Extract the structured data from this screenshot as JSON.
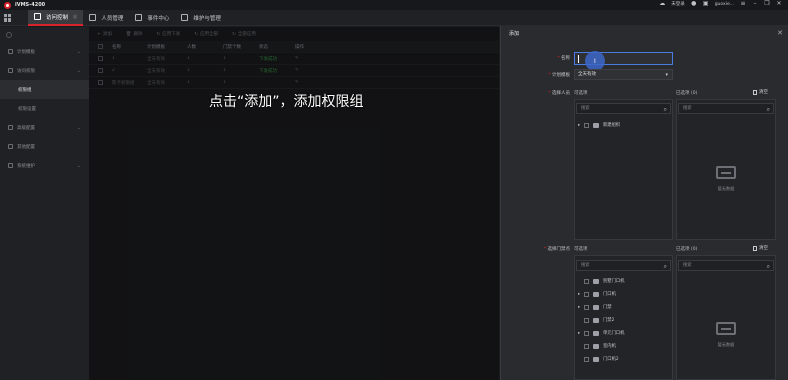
{
  "app": {
    "title": "iVMS-4200"
  },
  "titlebar": {
    "user": "guoxie...",
    "icons": [
      "cloud-icon",
      "user-icon",
      "image-icon",
      "menu-icon",
      "minimize-icon",
      "restore-icon",
      "close-icon"
    ],
    "login_label": "未登录"
  },
  "nav": {
    "tabs": [
      {
        "label": "访问控制",
        "active": true
      },
      {
        "label": "人员管理"
      },
      {
        "label": "事件中心"
      },
      {
        "label": "维护与管理"
      }
    ]
  },
  "sidebar": {
    "items": [
      {
        "label": "计划模板",
        "chevron": "⌄"
      },
      {
        "label": "访问权限",
        "chevron": "⌄"
      },
      {
        "label": "权限组",
        "sub": true,
        "selected": true
      },
      {
        "label": "权限设置",
        "sub": true
      },
      {
        "label": "高级配置",
        "chevron": "⌄"
      },
      {
        "label": "其他配置"
      },
      {
        "label": "系统维护",
        "chevron": "⌄"
      }
    ]
  },
  "main": {
    "toolbar": [
      "添加",
      "删除",
      "应用下发",
      "应用全部",
      "全部应用"
    ],
    "columns": [
      "名称",
      "计划模板",
      "人数",
      "门禁个数",
      "状态",
      "操作"
    ],
    "rows": [
      {
        "name": "1",
        "template": "全天有效",
        "people": "1",
        "doors": "1",
        "status": "下发成功"
      },
      {
        "name": "2",
        "template": "全天有效",
        "people": "1",
        "doors": "1",
        "status": "下发成功"
      },
      {
        "name": "陈卡权限组",
        "template": "全天有效",
        "people": "1",
        "doors": "1",
        "status": ""
      }
    ]
  },
  "caption": "点击“添加”，添加权限组",
  "panel": {
    "title": "添加",
    "name_label": "名称",
    "template_label": "计划模板",
    "template_value": "全天有效",
    "select_person_label": "选择人员",
    "select_door_label": "选择门禁点",
    "available": "可选项",
    "selected": "已选项",
    "selected_count": "(0)",
    "clear": "清空",
    "search_placeholder": "搜索",
    "no_data": "暂无数据",
    "person_tree": [
      {
        "label": "新建组织",
        "expand": true
      }
    ],
    "door_tree": [
      {
        "label": "别墅门口机",
        "expand": false
      },
      {
        "label": "门口机",
        "expand": true
      },
      {
        "label": "门禁",
        "expand": true
      },
      {
        "label": "门禁2",
        "expand": false
      },
      {
        "label": "单元门口机",
        "expand": true
      },
      {
        "label": "室内机",
        "expand": false
      },
      {
        "label": "门口机2",
        "expand": false
      }
    ]
  }
}
